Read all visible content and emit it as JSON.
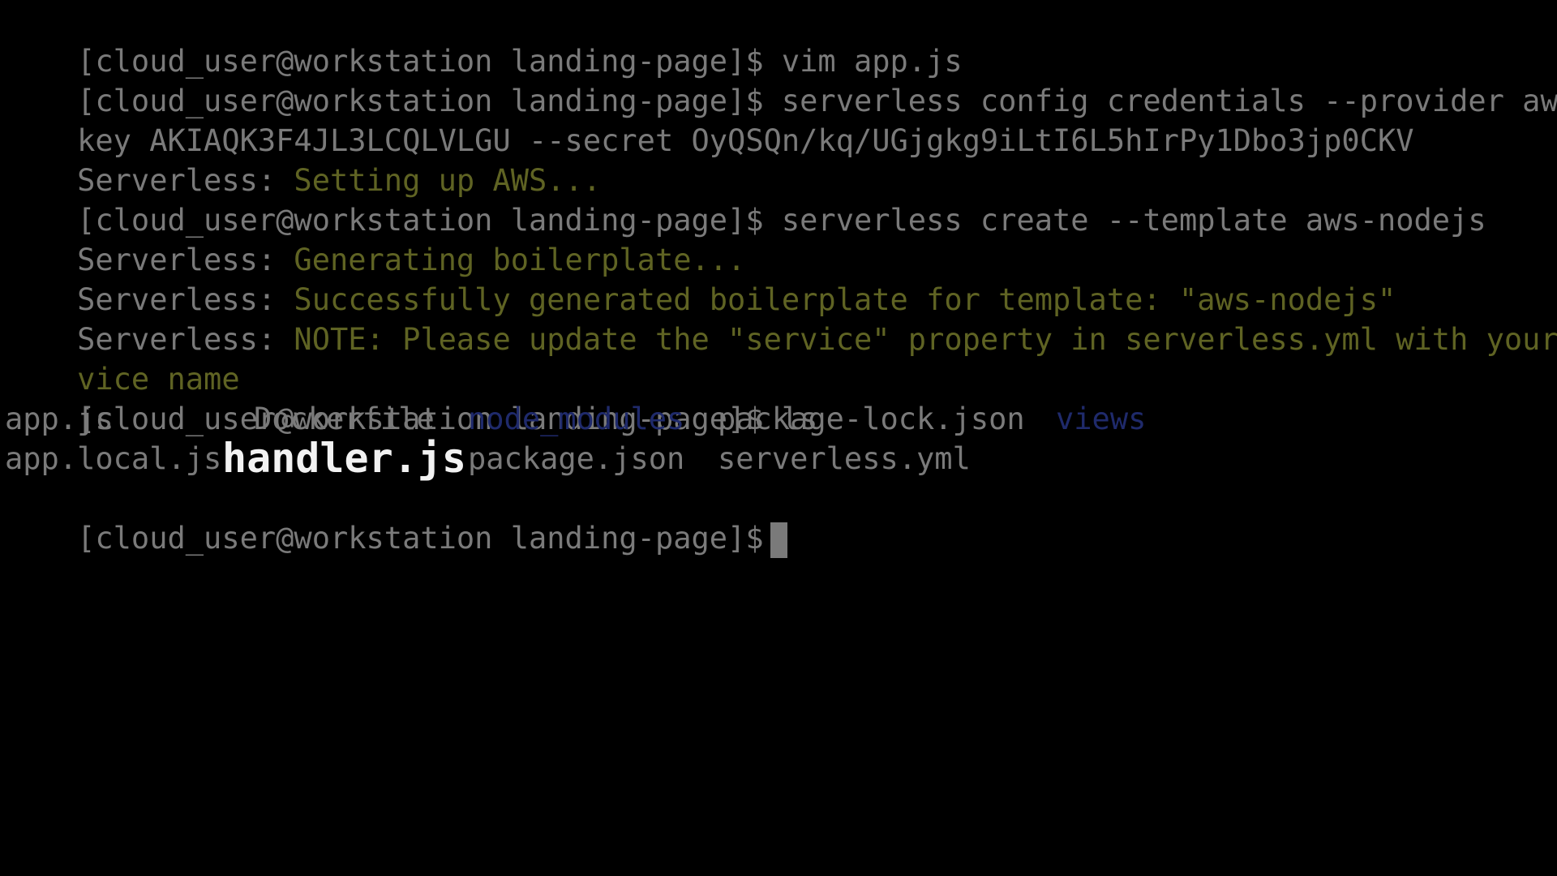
{
  "terminal": {
    "prompt": "[cloud_user@workstation landing-page]$",
    "lines": [
      {
        "cmd": " vim app.js"
      },
      {
        "cmd": " serverless config credentials --provider aws --"
      },
      {
        "text": "key AKIAQK3F4JL3LCQLVLGU --secret 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"
      },
      {
        "prefix": "Serverless: ",
        "body": "Setting up AWS..."
      },
      {
        "cmd": " serverless create --template aws-nodejs"
      },
      {
        "prefix": "Serverless: ",
        "body": "Generating boilerplate..."
      },
      {
        "prefix": "Serverless: ",
        "body": "Successfully generated boilerplate for template: \"aws-nodejs\""
      },
      {
        "prefix": "Serverless: ",
        "body": "NOTE: Please update the \"service\" property in serverless.yml with your ser"
      },
      {
        "body": "vice name"
      },
      {
        "cmd": " ls"
      }
    ],
    "ls_row1": {
      "col1": "app.js",
      "col2": "Dockerfile",
      "col3": "node_modules",
      "col4": "package-lock.json",
      "col5": "views"
    },
    "ls_row2": {
      "col1": "app.local.js",
      "col2": "handler.js",
      "col3": "package.json",
      "col4": "serverless.yml"
    }
  },
  "colors": {
    "background": "#000000",
    "text": "#7a7a7a",
    "message": "#5f6323",
    "directory": "#1f2a6b",
    "highlight": "#f2f2f2"
  }
}
